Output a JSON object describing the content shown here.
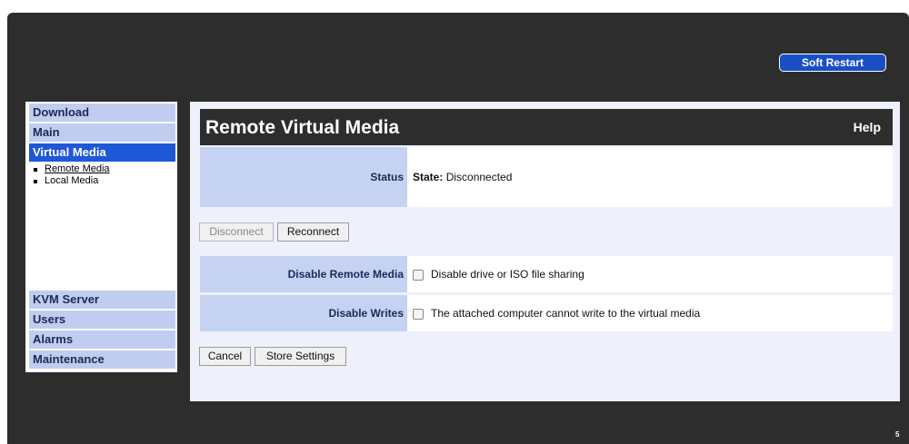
{
  "header": {
    "soft_restart_label": "Soft Restart"
  },
  "sidebar": {
    "items": [
      {
        "label": "Download"
      },
      {
        "label": "Main"
      },
      {
        "label": "Virtual Media",
        "active": true
      },
      {
        "label": "KVM Server"
      },
      {
        "label": "Users"
      },
      {
        "label": "Alarms"
      },
      {
        "label": "Maintenance"
      }
    ],
    "subitems": [
      {
        "label": "Remote Media",
        "current": true
      },
      {
        "label": "Local Media"
      }
    ]
  },
  "panel": {
    "title": "Remote Virtual Media",
    "help_label": "Help",
    "status": {
      "label": "Status",
      "state_label": "State:",
      "state_value": "Disconnected"
    },
    "buttons": {
      "disconnect": "Disconnect",
      "reconnect": "Reconnect"
    },
    "options": [
      {
        "label": "Disable Remote Media",
        "checkbox_text": "Disable drive or ISO file sharing",
        "checked": false
      },
      {
        "label": "Disable Writes",
        "checkbox_text": "The attached computer cannot write to the virtual media",
        "checked": false
      }
    ],
    "footer_buttons": {
      "cancel": "Cancel",
      "store": "Store Settings"
    }
  },
  "corner_mark": "5",
  "colors": {
    "frame_bg": "#2d2d2d",
    "accent": "#1f58d6",
    "nav_bg": "#c1cdf0",
    "label_bg": "#c5d2f1",
    "panel_bg": "#eef1fb"
  }
}
